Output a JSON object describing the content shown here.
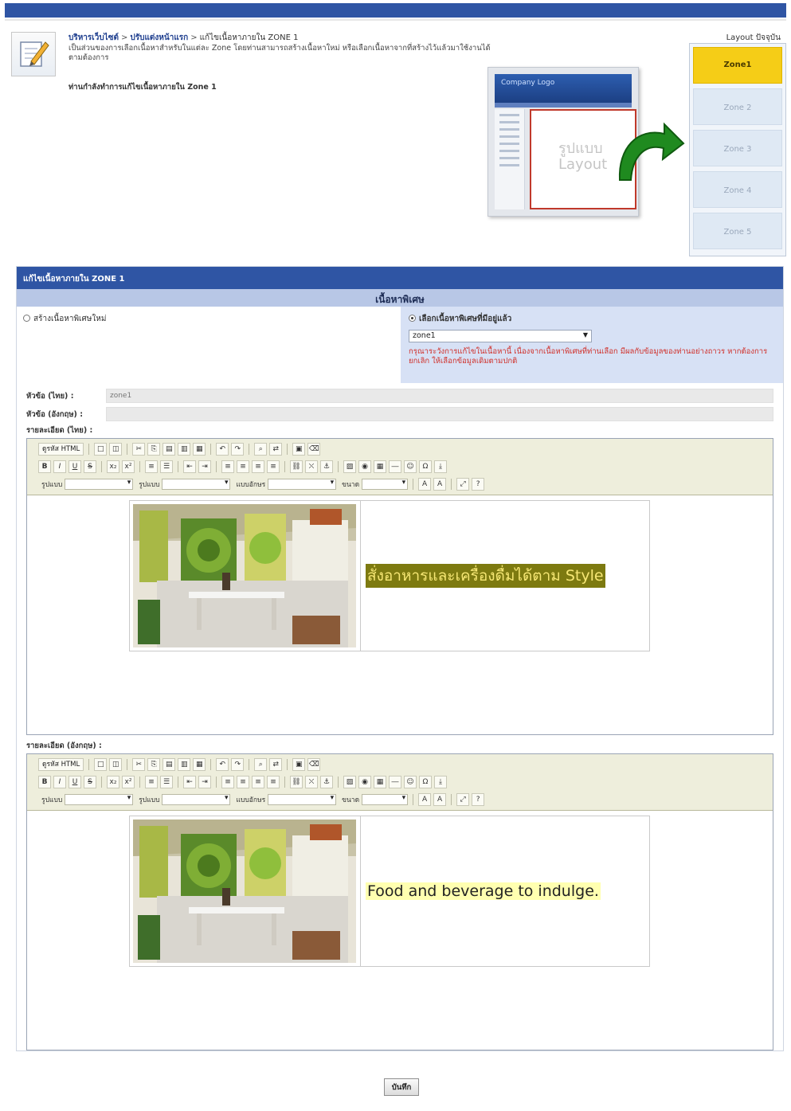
{
  "header": {
    "breadcrumb": [
      "บริหารเว็บไซต์",
      "ปรับแต่งหน้าแรก",
      "แก้ไขเนื้อหาภายใน ZONE 1"
    ],
    "description": "เป็นส่วนของการเลือกเนื้อหาสำหรับในแต่ละ Zone โดยท่านสามารถสร้างเนื้อหาใหม่ หรือเลือกเนื้อหาจากที่สร้างไว้แล้วมาใช้งานได้ตามต้องการ",
    "notice": "ท่านกำลังทำการแก้ไขเนื้อหาภายใน Zone 1",
    "layout_label": "Layout ปัจจุบัน",
    "preview_logo": "Company Logo",
    "preview_zone_text_th": "รูปแบบ",
    "preview_zone_text_en": "Layout"
  },
  "zones": [
    {
      "label": "Zone1",
      "active": true
    },
    {
      "label": "Zone 2",
      "active": false
    },
    {
      "label": "Zone 3",
      "active": false
    },
    {
      "label": "Zone 4",
      "active": false
    },
    {
      "label": "Zone 5",
      "active": false
    }
  ],
  "form": {
    "panel_title": "แก้ไขเนื้อหาภายใน ZONE 1",
    "section_title": "เนื้อหาพิเศษ",
    "option_create": "สร้างเนื้อหาพิเศษใหม่",
    "option_select": "เลือกเนื้อหาพิเศษที่มีอยู่แล้ว",
    "select_value": "zone1",
    "warning": "กรุณาระวังการแก้ไขในเนื้อหานี้ เนื่องจากเนื้อหาพิเศษที่ท่านเลือก มีผลกับข้อมูลของท่านอย่างถาวร หากต้องการยกเลิก ให้เลือกข้อมูลเดิมตามปกติ",
    "title_th_label": "หัวข้อ (ไทย) :",
    "title_th_value": "zone1",
    "title_en_label": "หัวข้อ (อังกฤษ) :",
    "title_en_value": "",
    "detail_th_label": "รายละเอียด (ไทย) :",
    "detail_en_label": "รายละเอียด (อังกฤษ) :",
    "save_label": "บันทึก"
  },
  "toolbar": {
    "source_label": "ดูรหัส HTML",
    "style_label": "รูปแบบ",
    "format_label": "รูปแบบ",
    "font_label": "แบบอักษร",
    "size_label": "ขนาด"
  },
  "content": {
    "th_text": "สั่งอาหารและเครื่องดื่มได้ตาม Style",
    "en_text": "Food and beverage to indulge."
  }
}
